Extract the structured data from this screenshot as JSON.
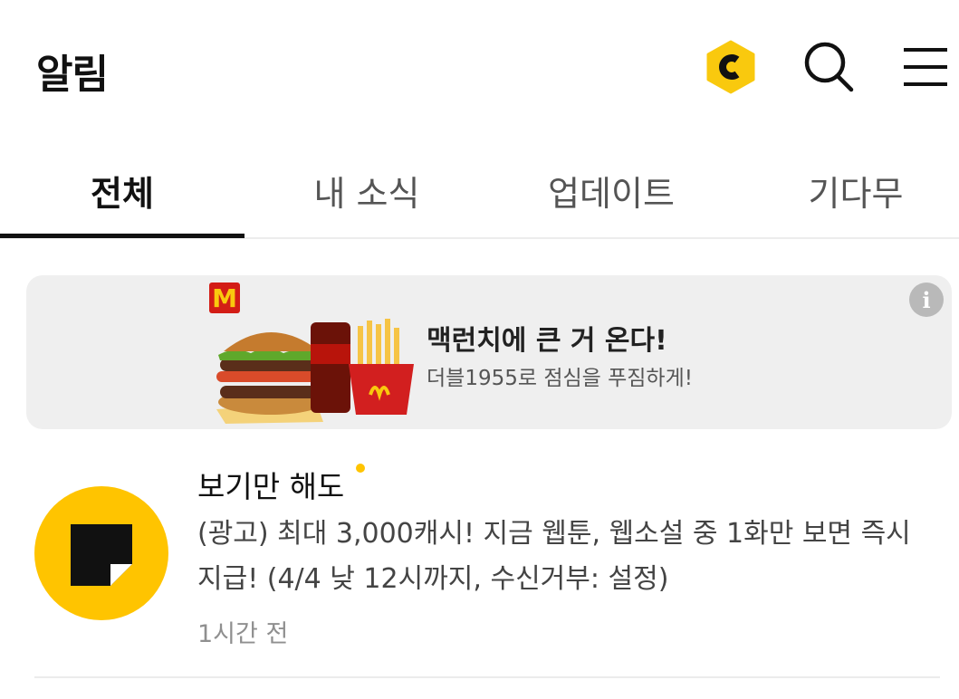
{
  "header": {
    "title": "알림",
    "icons": [
      "coin-c-icon",
      "search-icon",
      "menu-icon"
    ],
    "coin_color": "#f9c90e"
  },
  "tabs": [
    {
      "label": "전체",
      "active": true
    },
    {
      "label": "내 소식",
      "active": false
    },
    {
      "label": "업데이트",
      "active": false
    },
    {
      "label": "기다무",
      "active": false
    }
  ],
  "ad": {
    "brand_mark": "M",
    "title": "맥런치에 큰 거 온다!",
    "subtitle": "더블1955로 점심을 푸짐하게!",
    "info_symbol": "i"
  },
  "notifications": [
    {
      "sender": "보기만 해도",
      "unread": true,
      "message": "(광고) 최대 3,000캐시! 지금 웹툰, 웹소설 중 1화만 보면 즉시 지급! (4/4 낮 12시까지, 수신거부: 설정)",
      "time": "1시간 전",
      "avatar_color": "#ffc400"
    }
  ]
}
